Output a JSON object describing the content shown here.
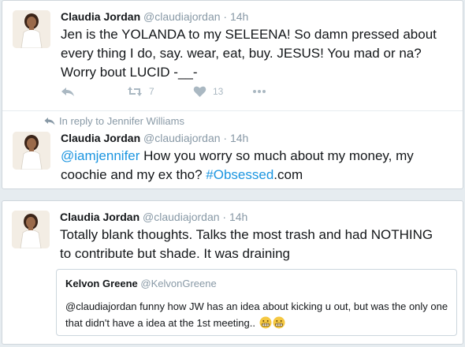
{
  "tweet1": {
    "name": "Claudia Jordan",
    "handle": "@claudiajordan",
    "dot": "·",
    "time": "14h",
    "text": "Jen is the YOLANDA to my SELEENA! So damn pressed about every thing I do, say. wear, eat, buy. JESUS! You mad or na? Worry bout LUCID -__-",
    "retweets": "7",
    "likes": "13",
    "icons": [
      "reply-icon",
      "retweet-icon",
      "heart-icon",
      "more-icon"
    ]
  },
  "reply_context": {
    "text": "In reply to Jennifer Williams",
    "icon": "reply-arrow-icon"
  },
  "tweet2": {
    "name": "Claudia Jordan",
    "handle": "@claudiajordan",
    "dot": "·",
    "time": "14h",
    "mention": "@iamjennifer",
    "text_middle": " How you worry so much about my money, my coochie and my ex tho? ",
    "hashtag": "#Obsessed",
    "text_end": ".com"
  },
  "tweet3": {
    "name": "Claudia Jordan",
    "handle": "@claudiajordan",
    "dot": "·",
    "time": "14h",
    "text": "Totally blank thoughts. Talks the most trash and had NOTHING to contribute but shade. It was draining",
    "quote": {
      "name": "Kelvon Greene",
      "handle": "@KelvonGreene",
      "text": "@claudiajordan funny how JW has an idea about kicking u out, but was the only one that didn't have a idea at the 1st meeting..",
      "emoji": [
        "grimace-emoji",
        "grimace-emoji"
      ]
    }
  },
  "colors": {
    "link": "#1b95e0",
    "muted": "#8899a6",
    "action": "#aab8c2",
    "background": "#e6ecf0"
  }
}
